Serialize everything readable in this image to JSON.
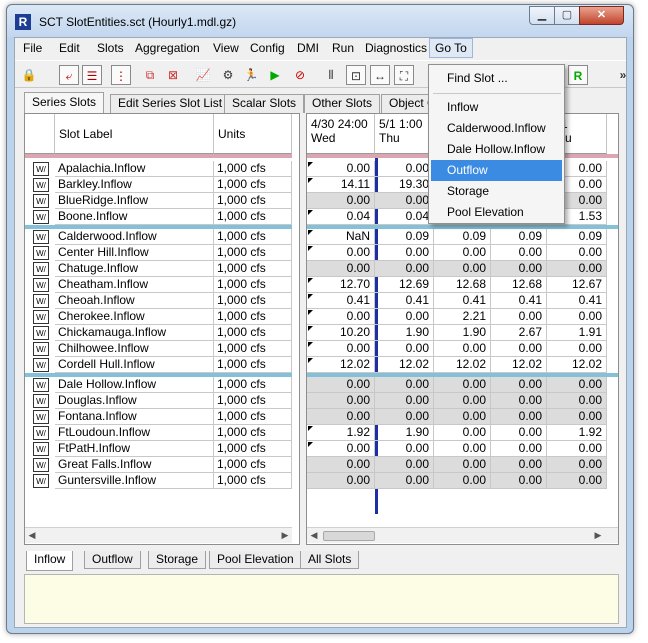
{
  "window": {
    "title": "SCT SlotEntities.sct (Hourly1.mdl.gz)",
    "app_icon_glyph": "R"
  },
  "menubar": {
    "items": [
      "File",
      "Edit",
      "Slots",
      "Aggregation",
      "View",
      "Config",
      "DMI",
      "Run",
      "Diagnostics",
      "Go To"
    ]
  },
  "goto_menu": {
    "items": [
      "Find Slot ...",
      "Inflow",
      "Calderwood.Inflow",
      "Dale Hollow.Inflow",
      "Outflow",
      "Storage",
      "Pool Elevation"
    ],
    "selected": "Outflow"
  },
  "toolbar": {
    "more": "»",
    "r_button": "R"
  },
  "tabs": [
    "Series Slots",
    "Edit Series Slot List",
    "Scalar Slots",
    "Other Slots",
    "Object C"
  ],
  "active_tab": "Series Slots",
  "left_table": {
    "col_label": "Slot Label",
    "col_units": "Units",
    "icon_text": "W/"
  },
  "right_table": {
    "columns": [
      {
        "date": "4/30 24:00",
        "day": "Wed"
      },
      {
        "date": "5/1 1:00",
        "day": "Thu"
      },
      {
        "date": "",
        "day": ""
      },
      {
        "date": "1 4:00",
        "day": "u"
      },
      {
        "date": "5/1",
        "day": "Thu"
      }
    ]
  },
  "groups": [
    {
      "rows": [
        {
          "label": "Apalachia.Inflow",
          "unit": "1,000 cfs",
          "values": [
            "0.00",
            "0.00",
            "",
            "",
            "0.00"
          ],
          "gray": false
        },
        {
          "label": "Barkley.Inflow",
          "unit": "1,000 cfs",
          "values": [
            "14.11",
            "19.30",
            "",
            "",
            "0.00"
          ],
          "gray": false
        },
        {
          "label": "BlueRidge.Inflow",
          "unit": "1,000 cfs",
          "values": [
            "0.00",
            "0.00",
            "",
            "",
            "0.00"
          ],
          "gray": true
        },
        {
          "label": "Boone.Inflow",
          "unit": "1,000 cfs",
          "values": [
            "0.04",
            "0.04",
            "",
            "",
            "1.53"
          ],
          "gray": false
        }
      ]
    },
    {
      "rows": [
        {
          "label": "Calderwood.Inflow",
          "unit": "1,000 cfs",
          "values": [
            "NaN",
            "0.09",
            "0.09",
            "0.09",
            "0.09"
          ],
          "gray": false
        },
        {
          "label": "Center Hill.Inflow",
          "unit": "1,000 cfs",
          "values": [
            "0.00",
            "0.00",
            "0.00",
            "0.00",
            "0.00"
          ],
          "gray": false
        },
        {
          "label": "Chatuge.Inflow",
          "unit": "1,000 cfs",
          "values": [
            "0.00",
            "0.00",
            "0.00",
            "0.00",
            "0.00"
          ],
          "gray": true
        },
        {
          "label": "Cheatham.Inflow",
          "unit": "1,000 cfs",
          "values": [
            "12.70",
            "12.69",
            "12.68",
            "12.68",
            "12.67"
          ],
          "gray": false
        },
        {
          "label": "Cheoah.Inflow",
          "unit": "1,000 cfs",
          "values": [
            "0.41",
            "0.41",
            "0.41",
            "0.41",
            "0.41"
          ],
          "gray": false
        },
        {
          "label": "Cherokee.Inflow",
          "unit": "1,000 cfs",
          "values": [
            "0.00",
            "0.00",
            "2.21",
            "0.00",
            "0.00"
          ],
          "gray": false
        },
        {
          "label": "Chickamauga.Inflow",
          "unit": "1,000 cfs",
          "values": [
            "10.20",
            "1.90",
            "1.90",
            "2.67",
            "1.91"
          ],
          "gray": false
        },
        {
          "label": "Chilhowee.Inflow",
          "unit": "1,000 cfs",
          "values": [
            "0.00",
            "0.00",
            "0.00",
            "0.00",
            "0.00"
          ],
          "gray": false
        },
        {
          "label": "Cordell Hull.Inflow",
          "unit": "1,000 cfs",
          "values": [
            "12.02",
            "12.02",
            "12.02",
            "12.02",
            "12.02"
          ],
          "gray": false
        }
      ]
    },
    {
      "rows": [
        {
          "label": "Dale Hollow.Inflow",
          "unit": "1,000 cfs",
          "values": [
            "0.00",
            "0.00",
            "0.00",
            "0.00",
            "0.00"
          ],
          "gray": true
        },
        {
          "label": "Douglas.Inflow",
          "unit": "1,000 cfs",
          "values": [
            "0.00",
            "0.00",
            "0.00",
            "0.00",
            "0.00"
          ],
          "gray": true
        },
        {
          "label": "Fontana.Inflow",
          "unit": "1,000 cfs",
          "values": [
            "0.00",
            "0.00",
            "0.00",
            "0.00",
            "0.00"
          ],
          "gray": true
        },
        {
          "label": "FtLoudoun.Inflow",
          "unit": "1,000 cfs",
          "values": [
            "1.92",
            "1.90",
            "0.00",
            "0.00",
            "1.92"
          ],
          "gray": false
        },
        {
          "label": "FtPatH.Inflow",
          "unit": "1,000 cfs",
          "values": [
            "0.00",
            "0.00",
            "0.00",
            "0.00",
            "0.00"
          ],
          "gray": false
        },
        {
          "label": "Great Falls.Inflow",
          "unit": "1,000 cfs",
          "values": [
            "0.00",
            "0.00",
            "0.00",
            "0.00",
            "0.00"
          ],
          "gray": true
        },
        {
          "label": "Guntersville.Inflow",
          "unit": "1,000 cfs",
          "values": [
            "0.00",
            "0.00",
            "0.00",
            "0.00",
            "0.00"
          ],
          "gray": true
        }
      ]
    }
  ],
  "bottom_tabs": [
    "Inflow",
    "Outflow",
    "Storage",
    "Pool Elevation",
    "All Slots"
  ],
  "active_bottom_tab": "Inflow"
}
